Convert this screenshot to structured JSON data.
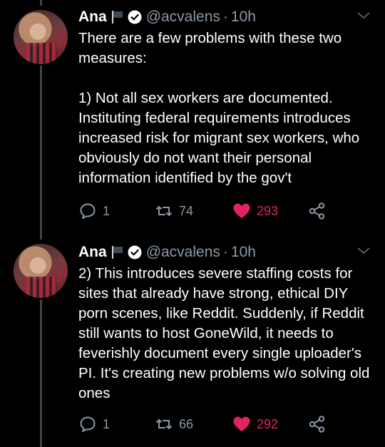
{
  "tweets": [
    {
      "author_name": "Ana",
      "handle": "@acvalens",
      "separator": "·",
      "time": "10h",
      "text": "There are a few problems with these two measures:\n\n1) Not all sex workers are documented. Instituting federal requirements introduces increased risk for migrant sex workers, who obviously do not want their personal information identified by the gov't",
      "replies": "1",
      "retweets": "74",
      "likes": "293",
      "liked": true
    },
    {
      "author_name": "Ana",
      "handle": "@acvalens",
      "separator": "·",
      "time": "10h",
      "text": "2) This introduces severe staffing costs for sites that already have strong, ethical DIY porn scenes, like Reddit. Suddenly, if Reddit still wants to host GoneWild, it needs to feverishly document every single uploader's PI. It's creating new problems w/o solving old ones",
      "replies": "1",
      "retweets": "66",
      "likes": "292",
      "liked": true
    }
  ],
  "icons": [
    "flag-icon",
    "verified-icon",
    "chevron-down-icon",
    "reply-icon",
    "retweet-icon",
    "heart-icon",
    "share-icon"
  ],
  "colors": {
    "background": "#000000",
    "text": "#ffffff",
    "secondary": "#8b98a5",
    "like": "#e0245e",
    "thread_line": "#3d4451"
  }
}
